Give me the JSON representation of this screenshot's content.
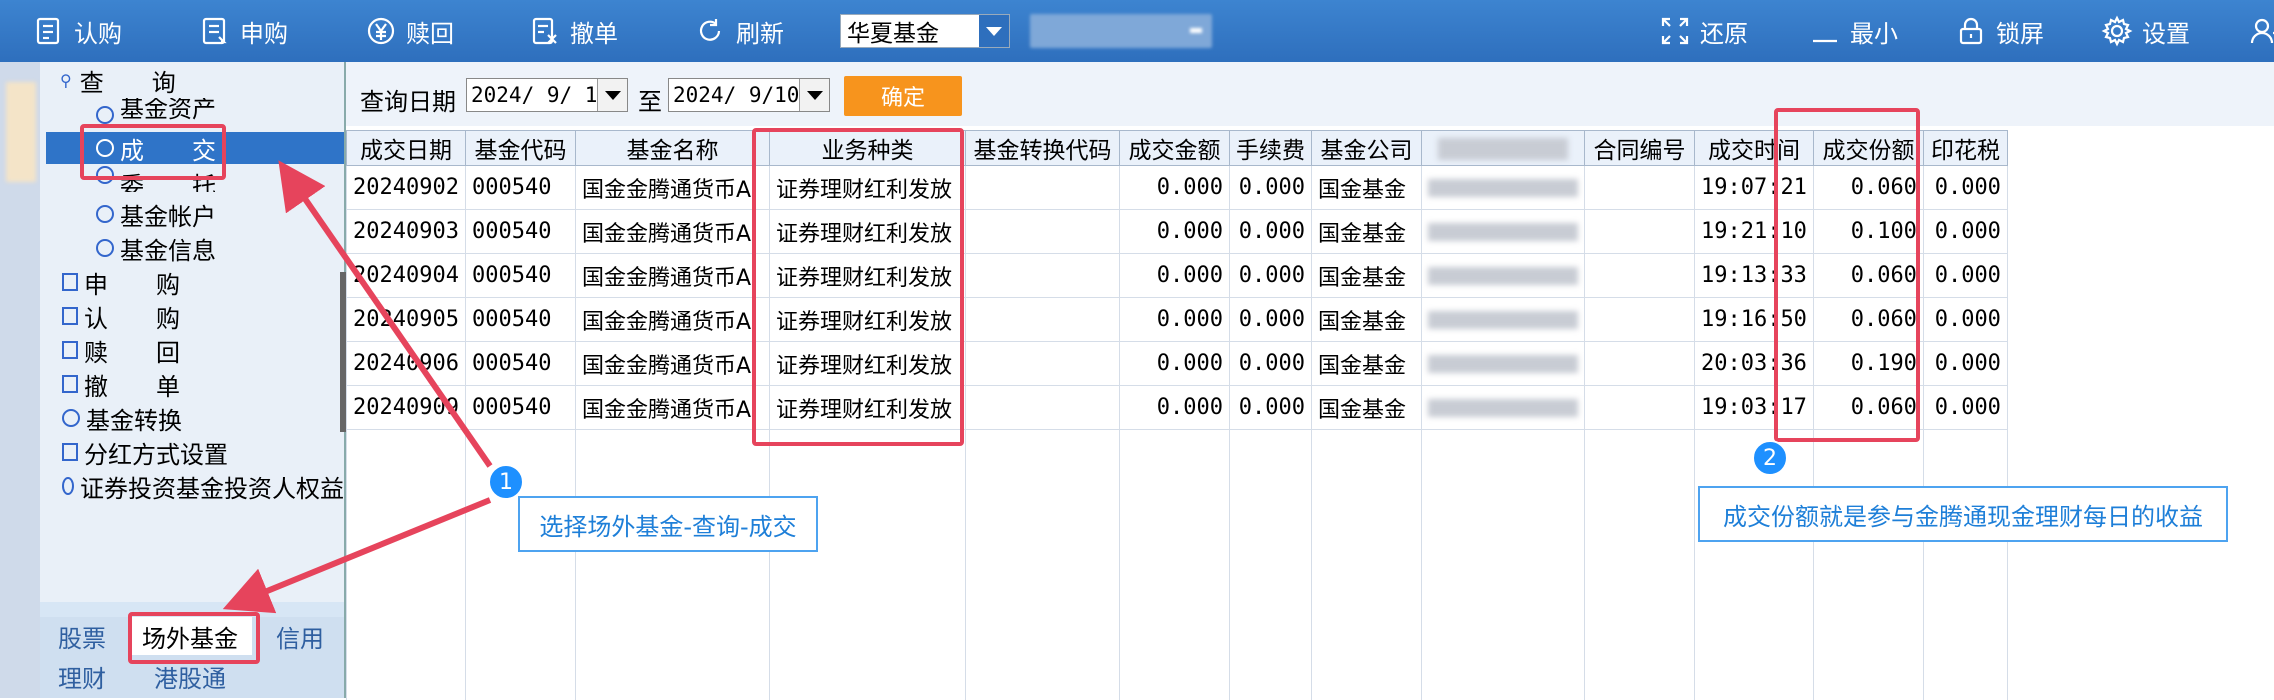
{
  "toolbar": {
    "buttons": [
      {
        "label": "认购",
        "icon": "subscribe-icon"
      },
      {
        "label": "申购",
        "icon": "purchase-icon"
      },
      {
        "label": "赎回",
        "icon": "redeem-icon"
      },
      {
        "label": "撤单",
        "icon": "cancel-order-icon"
      },
      {
        "label": "刷新",
        "icon": "refresh-icon"
      }
    ],
    "fund_company": "华夏基金",
    "right_buttons": [
      {
        "label": "还原",
        "icon": "restore-icon"
      },
      {
        "label": "最小",
        "icon": "minimize-icon"
      },
      {
        "label": "锁屏",
        "icon": "lock-icon"
      },
      {
        "label": "设置",
        "icon": "gear-icon"
      }
    ]
  },
  "tree": {
    "query": "查　　询",
    "fund_assets": "基金资产",
    "deals": "成　　交",
    "entrust": "委　　托",
    "fund_account": "基金帐户",
    "fund_info": "基金信息",
    "purchase": "申　　购",
    "subscribe": "认　　购",
    "redeem": "赎　　回",
    "cancel": "撤　　单",
    "convert": "基金转换",
    "dividend": "分红方式设置",
    "rights": "证券投资基金投资人权益"
  },
  "bottom_tabs": [
    "股票",
    "场外基金",
    "信用",
    "理财",
    "港股通"
  ],
  "filter": {
    "date_label": "查询日期",
    "from_date": "2024/ 9/ 1",
    "to_label": "至",
    "to_date": "2024/ 9/10",
    "confirm": "确定"
  },
  "table": {
    "headers": [
      "成交日期",
      "基金代码",
      "基金名称",
      "业务种类",
      "基金转换代码",
      "成交金额",
      "手续费",
      "基金公司",
      "",
      "合同编号",
      "成交时间",
      "成交份额",
      "印花税"
    ],
    "rows": [
      [
        "20240902",
        "000540",
        "国金金腾通货币A",
        "证券理财红利发放",
        "",
        "0.000",
        "0.000",
        "国金基金",
        "",
        "",
        "19:07:21",
        "0.060",
        "0.000"
      ],
      [
        "20240903",
        "000540",
        "国金金腾通货币A",
        "证券理财红利发放",
        "",
        "0.000",
        "0.000",
        "国金基金",
        "",
        "",
        "19:21:10",
        "0.100",
        "0.000"
      ],
      [
        "20240904",
        "000540",
        "国金金腾通货币A",
        "证券理财红利发放",
        "",
        "0.000",
        "0.000",
        "国金基金",
        "",
        "",
        "19:13:33",
        "0.060",
        "0.000"
      ],
      [
        "20240905",
        "000540",
        "国金金腾通货币A",
        "证券理财红利发放",
        "",
        "0.000",
        "0.000",
        "国金基金",
        "",
        "",
        "19:16:50",
        "0.060",
        "0.000"
      ],
      [
        "20240906",
        "000540",
        "国金金腾通货币A",
        "证券理财红利发放",
        "",
        "0.000",
        "0.000",
        "国金基金",
        "",
        "",
        "20:03:36",
        "0.190",
        "0.000"
      ],
      [
        "20240909",
        "000540",
        "国金金腾通货币A",
        "证券理财红利发放",
        "",
        "0.000",
        "0.000",
        "国金基金",
        "",
        "",
        "19:03:17",
        "0.060",
        "0.000"
      ]
    ]
  },
  "annotations": {
    "callout1_num": "1",
    "callout1_text": "选择场外基金-查询-成交",
    "callout2_num": "2",
    "callout2_text": "成交份额就是参与金腾通现金理财每日的收益",
    "accent_color": "#e6445c",
    "callout_color": "#1e90ff"
  }
}
